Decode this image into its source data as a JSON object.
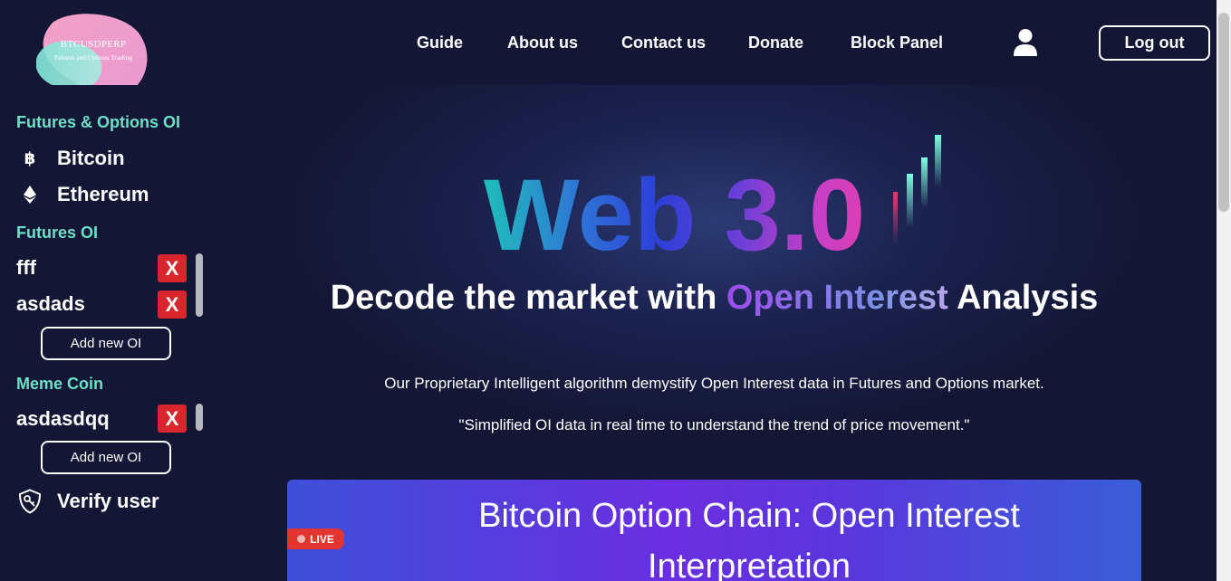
{
  "logo": {
    "title": "BTCUSDPERP",
    "subtitle": "Futures and Options Trading"
  },
  "nav": [
    "Guide",
    "About us",
    "Contact us",
    "Donate",
    "Block Panel"
  ],
  "header": {
    "logout_label": "Log out",
    "user_icon": "user-icon"
  },
  "sidebar": {
    "fo_heading": "Futures & Options OI",
    "fo_items": [
      {
        "label": "Bitcoin",
        "icon_text": "฿",
        "icon": "bitcoin-icon"
      },
      {
        "label": "Ethereum",
        "icon": "ethereum-icon"
      }
    ],
    "futures_heading": "Futures OI",
    "futures_items": [
      {
        "label": "fff"
      },
      {
        "label": "asdads"
      }
    ],
    "meme_heading": "Meme Coin",
    "meme_items": [
      {
        "label": "asdasdqq"
      }
    ],
    "delete_label": "X",
    "add_label": "Add new OI",
    "verify_label": "Verify user",
    "verify_icon": "shield-key-icon"
  },
  "hero": {
    "web3_text": "Web 3.0",
    "headline_before": "Decode the market with ",
    "headline_highlight": "Open Interest",
    "headline_after": " Analysis",
    "description": "Our Proprietary Intelligent algorithm demystify Open Interest data in Futures and Options market.",
    "quote": "\"Simplified OI data in real time to understand the trend of price movement.\""
  },
  "banner": {
    "title": "Bitcoin Option Chain: Open Interest Interpretation",
    "live_label": "LIVE"
  },
  "colors": {
    "background": "#131634",
    "accent_teal": "#6fe0c8",
    "delete_red": "#d8262c",
    "live_red": "#e3342f"
  }
}
